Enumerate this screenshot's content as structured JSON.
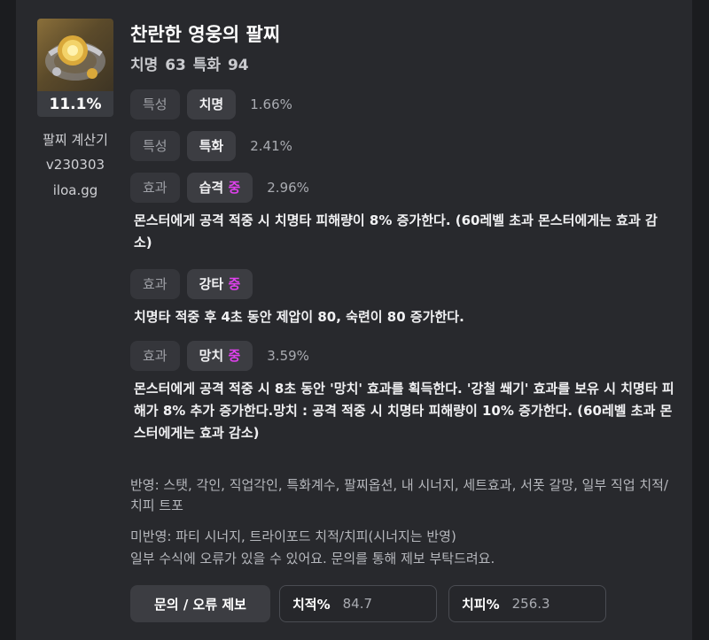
{
  "item": {
    "title": "찬란한 영웅의 팔찌",
    "stats_line": "치명 63 특화 94",
    "percent": "11.1%"
  },
  "sidebar": {
    "app_name": "팔찌 계산기",
    "version": "v230303",
    "site": "iloa.gg"
  },
  "options": [
    {
      "category": "특성",
      "name": "치명",
      "grade": "",
      "value": "1.66%",
      "description": ""
    },
    {
      "category": "특성",
      "name": "특화",
      "grade": "",
      "value": "2.41%",
      "description": ""
    },
    {
      "category": "효과",
      "name": "습격",
      "grade": "중",
      "value": "2.96%",
      "description": "몬스터에게 공격 적중 시 치명타 피해량이 8% 증가한다. (60레벨 초과 몬스터에게는 효과 감소)"
    },
    {
      "category": "효과",
      "name": "강타",
      "grade": "중",
      "value": "",
      "description": "치명타 적중 후 4초 동안 제압이 80, 숙련이 80 증가한다."
    },
    {
      "category": "효과",
      "name": "망치",
      "grade": "중",
      "value": "3.59%",
      "description": "몬스터에게 공격 적중 시 8초 동안 '망치' 효과를 획득한다. '강철 쐐기' 효과를 보유 시 치명타 피해가 8% 추가 증가한다.망치 : 공격 적중 시 치명타 피해량이 10% 증가한다. (60레벨 초과 몬스터에게는 효과 감소)"
    }
  ],
  "notes": {
    "reflected": "반영: 스탯, 각인, 직업각인, 특화계수, 팔찌옵션, 내 시너지, 세트효과, 서폿 갈망, 일부 직업 치적/치피 트포",
    "not_reflected": "미반영: 파티 시너지, 트라이포드 치적/치피(시너지는 반영)",
    "disclaimer": "일부 수식에 오류가 있을 수 있어요. 문의를 통해 제보 부탁드려요."
  },
  "footer": {
    "report_button": "문의 / 오류 제보",
    "crit_rate_label": "치적%",
    "crit_rate_value": "84.7",
    "crit_dmg_label": "치피%",
    "crit_dmg_value": "256.3"
  },
  "colors": {
    "grade_accent": "#e040ee",
    "background": "#28292d"
  },
  "icons": {
    "item_icon": "bracelet-icon"
  }
}
